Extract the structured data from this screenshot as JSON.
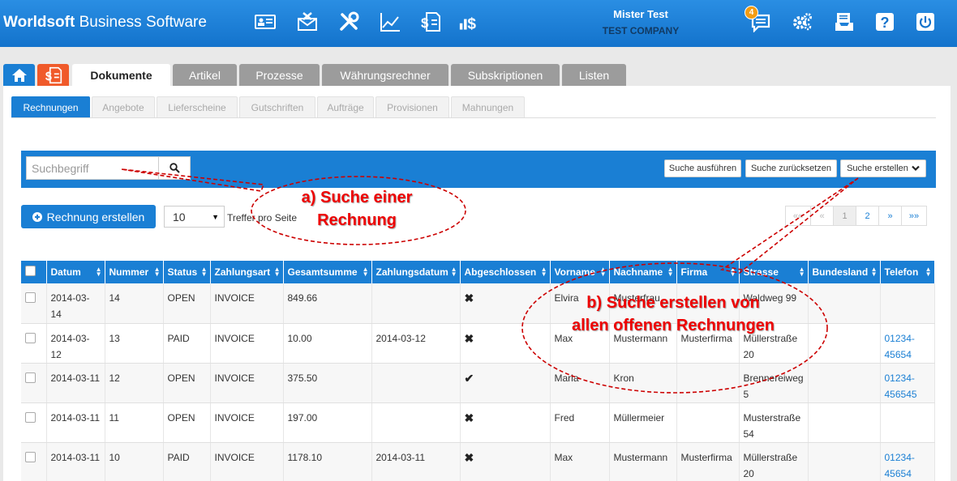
{
  "app": {
    "brand_bold": "Worldsoft",
    "brand_rest": " Business Software",
    "user_name": "Mister Test",
    "company": "TEST COMPANY",
    "notification_count": "4"
  },
  "icons": [
    "contact-card-icon",
    "mail-icon",
    "tools-icon",
    "chart-icon",
    "invoice-dollar-icon",
    "bars-dollar-icon",
    "chat-icon",
    "settings-icon",
    "inbox-icon",
    "help-icon",
    "power-icon"
  ],
  "main_tabs": [
    "Dokumente",
    "Artikel",
    "Prozesse",
    "Währungsrechner",
    "Subskriptionen",
    "Listen"
  ],
  "sub_tabs": [
    "Rechnungen",
    "Angebote",
    "Lieferscheine",
    "Gutschriften",
    "Aufträge",
    "Provisionen",
    "Mahnungen"
  ],
  "search": {
    "placeholder": "Suchbegriff",
    "execute_label": "Suche ausführen",
    "reset_label": "Suche zurücksetzen",
    "create_label": "Suche erstellen"
  },
  "toolbar": {
    "create_invoice_label": "Rechnung erstellen",
    "per_page_value": "10",
    "per_page_label": "Treffer pro Seite"
  },
  "pagination": [
    "««",
    "«",
    "1",
    "2",
    "»",
    "»»"
  ],
  "table": {
    "columns": [
      "Datum",
      "Nummer",
      "Status",
      "Zahlungsart",
      "Gesamtsumme",
      "Zahlungsdatum",
      "Abgeschlossen",
      "Vorname",
      "Nachname",
      "Firma",
      "Strasse",
      "Bundesland",
      "Telefon"
    ],
    "rows": [
      {
        "datum": "2014-03-14",
        "nummer": "14",
        "status": "OPEN",
        "zahlungsart": "INVOICE",
        "gesamtsumme": "849.66",
        "zahlungsdatum": "",
        "abgeschlossen": "✖",
        "vorname": "Elvira",
        "nachname": "Musterfrau",
        "firma": "",
        "strasse": "Waldweg 99",
        "bundesland": "",
        "telefon": ""
      },
      {
        "datum": "2014-03-12",
        "nummer": "13",
        "status": "PAID",
        "zahlungsart": "INVOICE",
        "gesamtsumme": "10.00",
        "zahlungsdatum": "2014-03-12",
        "abgeschlossen": "✖",
        "vorname": "Max",
        "nachname": "Mustermann",
        "firma": "Musterfirma",
        "strasse": "Müllerstraße 20",
        "bundesland": "",
        "telefon": "01234-45654"
      },
      {
        "datum": "2014-03-11",
        "nummer": "12",
        "status": "OPEN",
        "zahlungsart": "INVOICE",
        "gesamtsumme": "375.50",
        "zahlungsdatum": "",
        "abgeschlossen": "✔",
        "vorname": "Maria",
        "nachname": "Kron",
        "firma": "",
        "strasse": "Brennereiweg 5",
        "bundesland": "",
        "telefon": "01234-456545"
      },
      {
        "datum": "2014-03-11",
        "nummer": "11",
        "status": "OPEN",
        "zahlungsart": "INVOICE",
        "gesamtsumme": "197.00",
        "zahlungsdatum": "",
        "abgeschlossen": "✖",
        "vorname": "Fred",
        "nachname": "Müllermeier",
        "firma": "",
        "strasse": "Musterstraße 54",
        "bundesland": "",
        "telefon": ""
      },
      {
        "datum": "2014-03-11",
        "nummer": "10",
        "status": "PAID",
        "zahlungsart": "INVOICE",
        "gesamtsumme": "1178.10",
        "zahlungsdatum": "2014-03-11",
        "abgeschlossen": "✖",
        "vorname": "Max",
        "nachname": "Mustermann",
        "firma": "Musterfirma",
        "strasse": "Müllerstraße 20",
        "bundesland": "",
        "telefon": "01234-45654"
      }
    ]
  },
  "annotations": {
    "a": "a) Suche einer Rechnung",
    "b": "b) Suche erstellen von allen offenen Rechnungen"
  }
}
